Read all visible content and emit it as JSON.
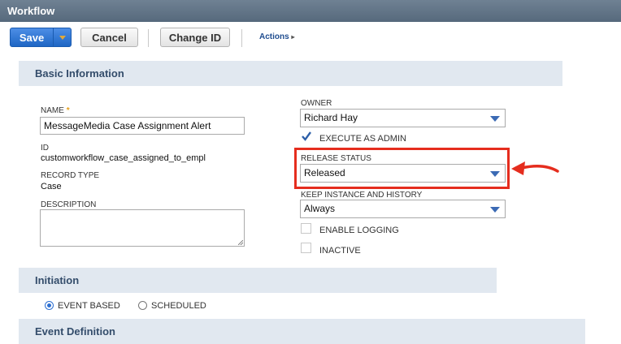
{
  "window": {
    "title": "Workflow"
  },
  "toolbar": {
    "save_label": "Save",
    "cancel_label": "Cancel",
    "change_id_label": "Change ID",
    "actions_label": "Actions",
    "actions_caret": "▸"
  },
  "sections": {
    "basic_information": "Basic Information",
    "initiation": "Initiation",
    "event_definition": "Event Definition"
  },
  "fields": {
    "name": {
      "label": "NAME",
      "required_marker": "*",
      "value": "MessageMedia Case Assignment Alert"
    },
    "id": {
      "label": "ID",
      "value": "customworkflow_case_assigned_to_empl"
    },
    "record_type": {
      "label": "RECORD TYPE",
      "value": "Case"
    },
    "description": {
      "label": "DESCRIPTION",
      "value": ""
    },
    "owner": {
      "label": "OWNER",
      "value": "Richard Hay"
    },
    "execute_as_admin": {
      "label": "EXECUTE AS ADMIN",
      "checked": true
    },
    "release_status": {
      "label": "RELEASE STATUS",
      "value": "Released"
    },
    "keep_instance": {
      "label": "KEEP INSTANCE AND HISTORY",
      "value": "Always"
    },
    "enable_logging": {
      "label": "ENABLE LOGGING",
      "checked": false
    },
    "inactive": {
      "label": "INACTIVE",
      "checked": false
    }
  },
  "initiation": {
    "options": [
      {
        "label": "EVENT BASED",
        "selected": true
      },
      {
        "label": "SCHEDULED",
        "selected": false
      }
    ]
  },
  "colors": {
    "accent": "#1e66c4",
    "highlight_box": "#e52d1e",
    "section_bg": "#e1e8f0"
  }
}
